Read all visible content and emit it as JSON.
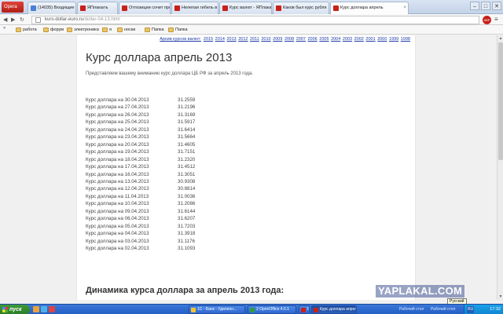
{
  "browser": {
    "opera_label": "Opera",
    "tabs": [
      {
        "label": "(14035) Входящие - gm",
        "color": "#4a7fd4",
        "active": false
      },
      {
        "label": "ЯПлакалъ",
        "color": "#c8201a",
        "active": false
      },
      {
        "label": "Отпозиции сочит прото",
        "color": "#c8201a",
        "active": false
      },
      {
        "label": "Нелепая гибель в Бра",
        "color": "#c8201a",
        "active": false
      },
      {
        "label": "Курс валют - ЯПлакалъ",
        "color": "#c8201a",
        "active": false
      },
      {
        "label": "Каков был курс рубля ",
        "color": "#c8201a",
        "active": false
      },
      {
        "label": "Курс доллара апрель",
        "color": "#c8201a",
        "active": true
      }
    ],
    "url_domain": "kurs-dollar-euro.ru",
    "url_path": "/dollar-04-13.html",
    "bookmarks": [
      "работа",
      "форум",
      "электроника",
      "я",
      "носки",
      "Папка",
      "Папка"
    ]
  },
  "page": {
    "archive_label": "Архив курсов валют:",
    "years": [
      "2015",
      "2014",
      "2013",
      "2012",
      "2011",
      "2010",
      "2009",
      "2008",
      "2007",
      "2006",
      "2005",
      "2004",
      "2003",
      "2002",
      "2001",
      "2000",
      "1999",
      "1998"
    ],
    "title": "Курс доллара апрель 2013",
    "intro": "Представляем вашему вниманию курс доллара ЦБ РФ за апрель 2013 года.",
    "rates": [
      {
        "label": "Курс доллара на 30.04.2013",
        "value": "31.2559"
      },
      {
        "label": "Курс доллара на 27.04.2013",
        "value": "31.2196"
      },
      {
        "label": "Курс доллара на 26.04.2013",
        "value": "31.3169"
      },
      {
        "label": "Курс доллара на 25.04.2013",
        "value": "31.5917"
      },
      {
        "label": "Курс доллара на 24.04.2013",
        "value": "31.6414"
      },
      {
        "label": "Курс доллара на 23.04.2013",
        "value": "31.5664"
      },
      {
        "label": "Курс доллара на 20.04.2013",
        "value": "31.4605"
      },
      {
        "label": "Курс доллара на 19.04.2013",
        "value": "31.7151"
      },
      {
        "label": "Курс доллара на 18.04.2013",
        "value": "31.2320"
      },
      {
        "label": "Курс доллара на 17.04.2013",
        "value": "31.4512"
      },
      {
        "label": "Курс доллара на 16.04.2013",
        "value": "31.3051"
      },
      {
        "label": "Курс доллара на 13.04.2013",
        "value": "30.9308"
      },
      {
        "label": "Курс доллара на 12.04.2013",
        "value": "30.8814"
      },
      {
        "label": "Курс доллара на 11.04.2013",
        "value": "31.0036"
      },
      {
        "label": "Курс доллара на 10.04.2013",
        "value": "31.2086"
      },
      {
        "label": "Курс доллара на 09.04.2013",
        "value": "31.6144"
      },
      {
        "label": "Курс доллара на 06.04.2013",
        "value": "31.6207"
      },
      {
        "label": "Курс доллара на 05.04.2013",
        "value": "31.7203"
      },
      {
        "label": "Курс доллара на 04.04.2013",
        "value": "31.3918"
      },
      {
        "label": "Курс доллара на 03.04.2013",
        "value": "31.1176"
      },
      {
        "label": "Курс доллара на 02.04.2013",
        "value": "31.1093"
      }
    ],
    "subtitle": "Динамика курса доллара за апрель 2013 года:"
  },
  "overlay": {
    "watermark": "YAPLAKAL.COM",
    "tooltip": "Русский"
  },
  "taskbar": {
    "start_label": "пуск",
    "buttons": [
      {
        "label": "1С - Банк - Удаленн...",
        "color": "#f4c430",
        "active": false
      },
      {
        "label": "2 OpenOffice 4.0.1",
        "color": "#2f9e44",
        "active": false
      },
      {
        "label": "Opera",
        "color": "#c8201a",
        "active": false
      },
      {
        "label": "Курс доллара апрел...",
        "color": "#c8201a",
        "active": true
      }
    ],
    "side_texts": [
      "Рабочий стол",
      "Рабочий стол"
    ],
    "lang": "RU",
    "clock": "17:32"
  }
}
